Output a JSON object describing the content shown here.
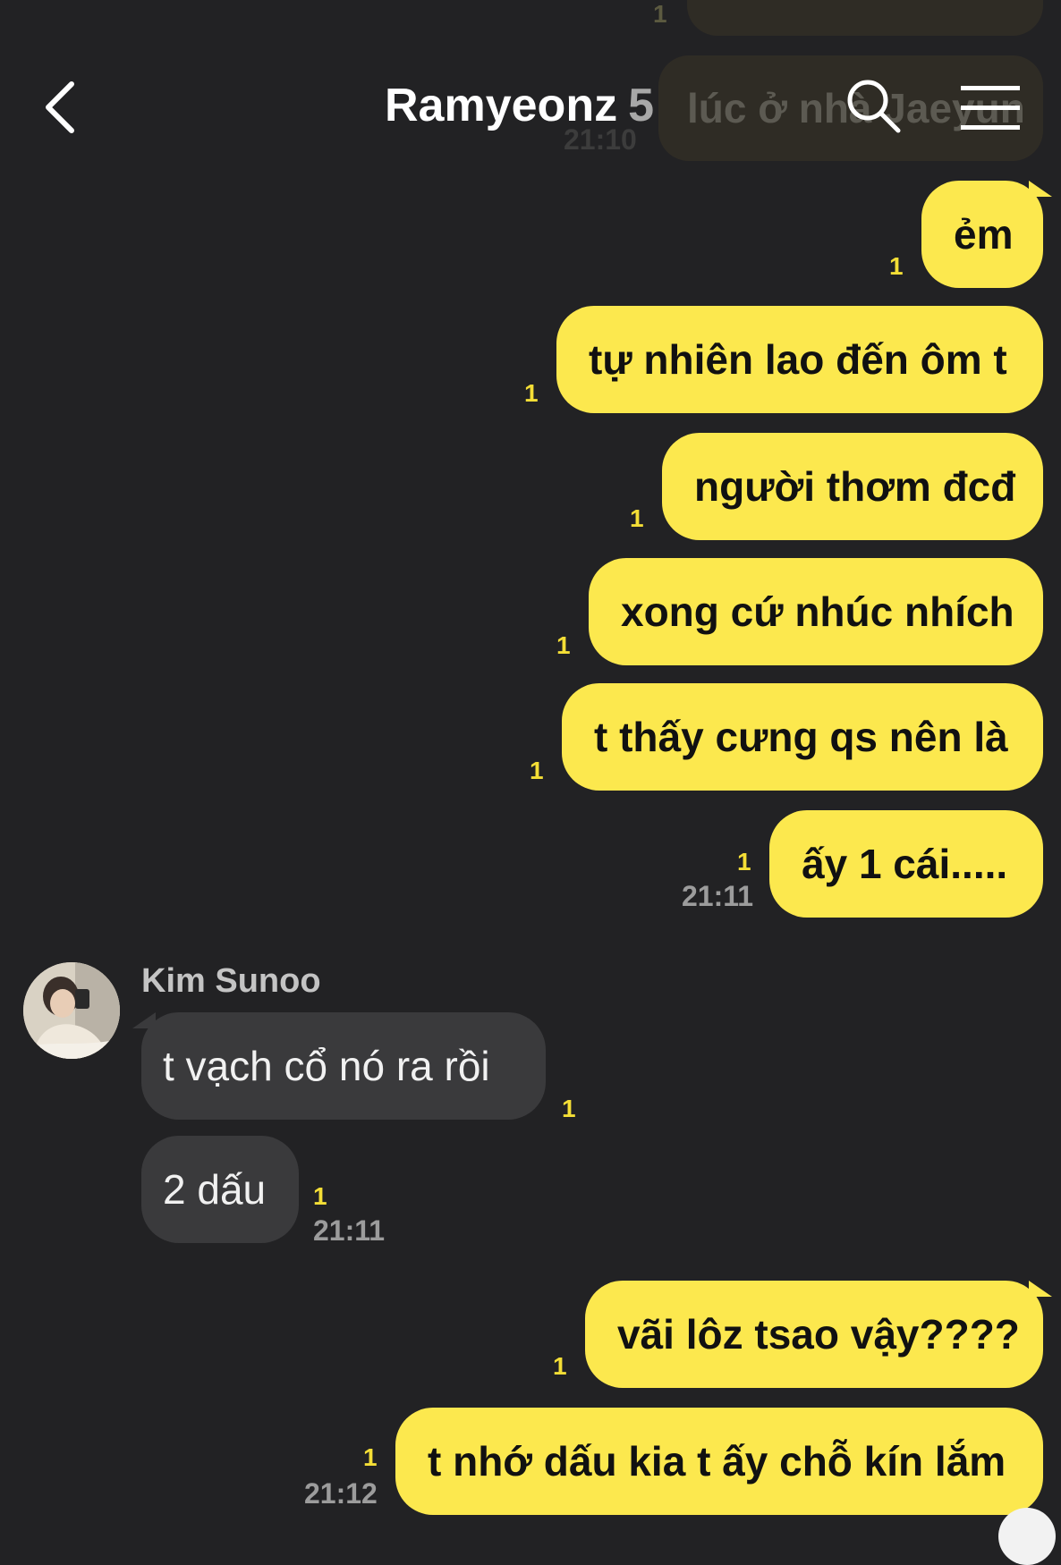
{
  "header": {
    "title": "Ramyeonz",
    "member_count": "5"
  },
  "background": {
    "ghost_unread": "1",
    "ghost_message": "lúc ở nhà Jaeyun",
    "ghost_time": "21:10"
  },
  "messages": [
    {
      "sender": "me",
      "text": "ẻm",
      "unread": "1"
    },
    {
      "sender": "me",
      "text": "tự nhiên lao đến ôm t",
      "unread": "1"
    },
    {
      "sender": "me",
      "text": "người thơm đcđ",
      "unread": "1"
    },
    {
      "sender": "me",
      "text": "xong cứ nhúc nhích",
      "unread": "1"
    },
    {
      "sender": "me",
      "text": "t thấy cưng qs nên là",
      "unread": "1"
    },
    {
      "sender": "me",
      "text": "ấy 1 cái.....",
      "unread": "1",
      "time": "21:11"
    },
    {
      "sender": "Kim Sunoo",
      "text": "t vạch cổ nó ra rồi",
      "unread": "1"
    },
    {
      "sender": "Kim Sunoo",
      "text": "2 dấu",
      "unread": "1",
      "time": "21:11"
    },
    {
      "sender": "me",
      "text": "vãi lôz tsao vậy????",
      "unread": "1"
    },
    {
      "sender": "me",
      "text": "t nhớ dấu kia t ấy chỗ kín lắm",
      "unread": "1",
      "time": "21:12"
    }
  ],
  "contact": {
    "name": "Kim Sunoo"
  },
  "icons": {
    "back": "chevron-left-icon",
    "search": "search-icon",
    "menu": "hamburger-menu-icon"
  },
  "colors": {
    "background": "#222224",
    "my_bubble": "#fce84e",
    "their_bubble": "#3a3a3c",
    "unread": "#f4de36"
  }
}
